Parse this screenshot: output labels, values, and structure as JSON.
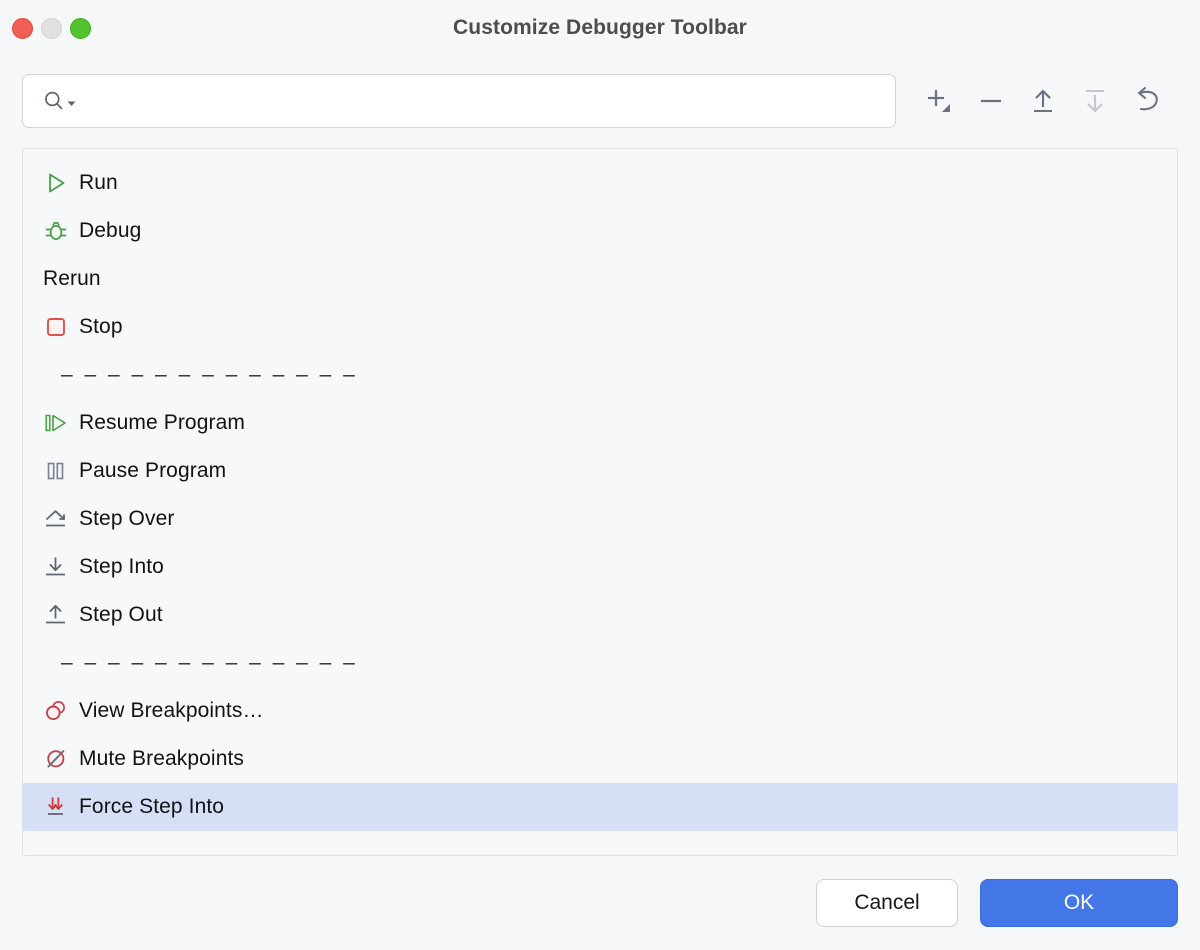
{
  "window": {
    "title": "Customize Debugger Toolbar",
    "traffic_lights": [
      {
        "name": "close",
        "color": "#ef5f56"
      },
      {
        "name": "minimize",
        "color": "#e0e0e2"
      },
      {
        "name": "maximize",
        "color": "#54c22e"
      }
    ]
  },
  "search": {
    "value": "",
    "placeholder": "",
    "icon": "search-icon",
    "dropdown_icon": "chevron-down-icon"
  },
  "toolbar": {
    "buttons": [
      {
        "name": "add-button",
        "icon": "plus-with-dropdown-icon",
        "enabled": true
      },
      {
        "name": "remove-button",
        "icon": "minus-icon",
        "enabled": true
      },
      {
        "name": "move-up-button",
        "icon": "arrow-up-icon",
        "enabled": true
      },
      {
        "name": "move-down-button",
        "icon": "arrow-down-icon",
        "enabled": false
      },
      {
        "name": "reset-button",
        "icon": "undo-arrow-icon",
        "enabled": true
      }
    ]
  },
  "list": {
    "separator_text": "– – – – – – – – – – – – –",
    "items": [
      {
        "type": "item",
        "label": "Run",
        "icon": "run-icon",
        "selected": false
      },
      {
        "type": "item",
        "label": "Debug",
        "icon": "debug-bug-icon",
        "selected": false
      },
      {
        "type": "item",
        "label": "Rerun",
        "icon": "",
        "selected": false
      },
      {
        "type": "item",
        "label": "Stop",
        "icon": "stop-icon",
        "selected": false
      },
      {
        "type": "separator",
        "label": "– – – – – – – – – – – – –",
        "icon": "",
        "selected": false
      },
      {
        "type": "item",
        "label": "Resume Program",
        "icon": "resume-program-icon",
        "selected": false
      },
      {
        "type": "item",
        "label": "Pause Program",
        "icon": "pause-program-icon",
        "selected": false
      },
      {
        "type": "item",
        "label": "Step Over",
        "icon": "step-over-icon",
        "selected": false
      },
      {
        "type": "item",
        "label": "Step Into",
        "icon": "step-into-icon",
        "selected": false
      },
      {
        "type": "item",
        "label": "Step Out",
        "icon": "step-out-icon",
        "selected": false
      },
      {
        "type": "separator",
        "label": "– – – – – – – – – – – – –",
        "icon": "",
        "selected": false
      },
      {
        "type": "item",
        "label": "View Breakpoints…",
        "icon": "view-breakpoints-icon",
        "selected": false
      },
      {
        "type": "item",
        "label": "Mute Breakpoints",
        "icon": "mute-breakpoints-icon",
        "selected": false
      },
      {
        "type": "item",
        "label": "Force Step Into",
        "icon": "force-step-into-icon",
        "selected": true
      }
    ]
  },
  "footer": {
    "cancel_label": "Cancel",
    "ok_label": "OK"
  },
  "colors": {
    "selection": "#d7dff7",
    "primary_button": "#4377e8",
    "run_green": "#4a9e4a",
    "stop_red": "#d9544f",
    "breakpoint_red": "#c8424a",
    "icon_gray": "#6b7180"
  }
}
